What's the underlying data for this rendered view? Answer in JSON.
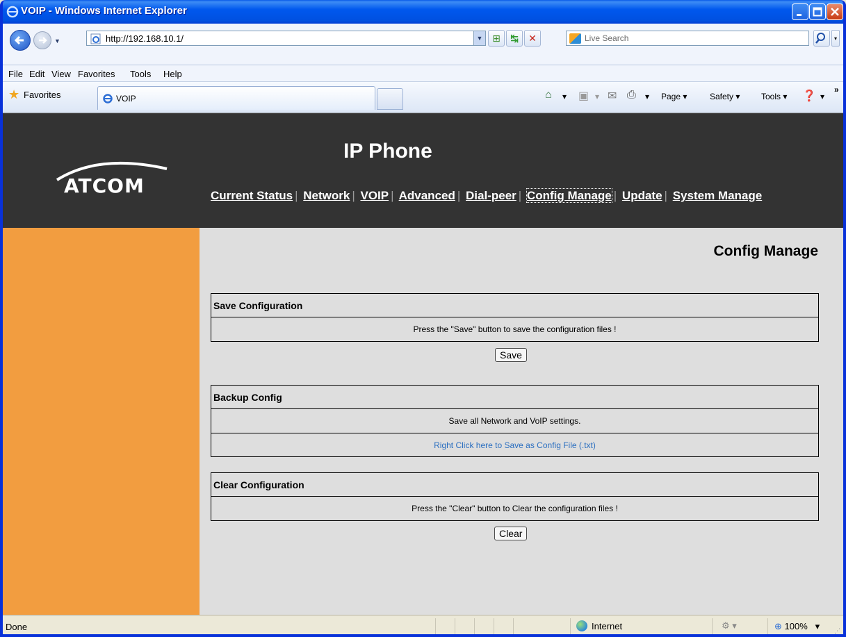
{
  "window": {
    "title": "VOIP - Windows Internet Explorer"
  },
  "browser": {
    "url": "http://192.168.10.1/",
    "search_placeholder": "Live Search",
    "menu": [
      "File",
      "Edit",
      "View",
      "Favorites",
      "Tools",
      "Help"
    ],
    "favorites_label": "Favorites",
    "tab_title": "VOIP",
    "commands": {
      "page": "Page ▾",
      "safety": "Safety ▾",
      "tools": "Tools ▾"
    },
    "status_text": "Done",
    "zone": "Internet",
    "zoom": "100%"
  },
  "header": {
    "logo": "ATCOM",
    "product_title": "IP Phone",
    "nav": [
      "Current Status",
      "Network",
      "VOIP",
      "Advanced",
      "Dial-peer",
      "Config Manage",
      "Update",
      "System Manage"
    ],
    "active_nav": "Config Manage"
  },
  "content": {
    "heading": "Config Manage",
    "save": {
      "title": "Save Configuration",
      "text": "Press the \"Save\" button to save the configuration files !",
      "button": "Save"
    },
    "backup": {
      "title": "Backup Config",
      "text": "Save all Network and VoIP settings.",
      "link": "Right Click here to Save as Config File (.txt)"
    },
    "clear": {
      "title": "Clear Configuration",
      "text": "Press the \"Clear\" button to Clear the configuration files !",
      "button": "Clear"
    }
  },
  "colors": {
    "header_bg": "#333333",
    "sidebar": "#F29D40",
    "content_bg": "#DEDEDE",
    "link": "#2B6FC0"
  }
}
